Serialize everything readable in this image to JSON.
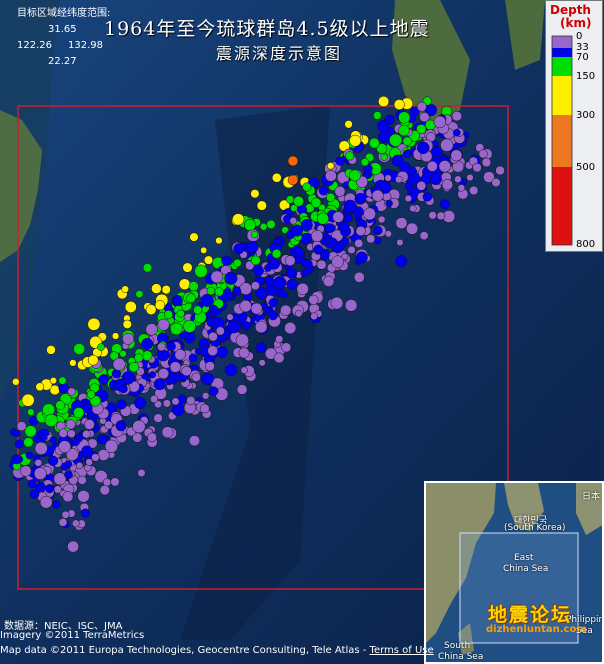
{
  "title_line1": "1964年至今琉球群岛4.5级以上地震",
  "title_line2": "震源深度示意图",
  "region": {
    "label": "目标区域经纬度范围:",
    "north": "31.65",
    "west": "122.26",
    "east": "132.98",
    "south": "22.27"
  },
  "legend": {
    "title": "Depth",
    "unit": "(km)",
    "ticks": [
      "0",
      "33",
      "70",
      "150",
      "300",
      "500",
      "800"
    ],
    "colors": {
      "0-33": "#9966cc",
      "33-70": "#0000ee",
      "70-150": "#00dd00",
      "150-300": "#ffee00",
      "300-500": "#ff6600",
      "500-800": "#ee0000"
    }
  },
  "footer": {
    "source": "数据源：NEIC、ISC、JMA",
    "imagery": "Imagery ©2011 TerraMetrics",
    "mapdata": "Map data ©2011 Europa Technologies, Geocentre Consulting, Tele Atlas - ",
    "terms": "Terms of Use"
  },
  "inset": {
    "korea": "대한민국",
    "korea_en": "(South Korea)",
    "east_china_sea": "East",
    "east_china_sea2": "China Sea",
    "philippine_sea": "Philippine",
    "sea": "Sea",
    "south_china_sea": "South",
    "south_china_sea2": "China Sea",
    "japan": "日本"
  },
  "watermark": "地震论坛",
  "watermark_url": "dizhenluntan.com",
  "colors": {
    "study_area_outline": "#cc1e2e",
    "ocean": "#12346a",
    "land": "#4a6a3a"
  },
  "icons": [
    "earthquake-marker-icon"
  ]
}
